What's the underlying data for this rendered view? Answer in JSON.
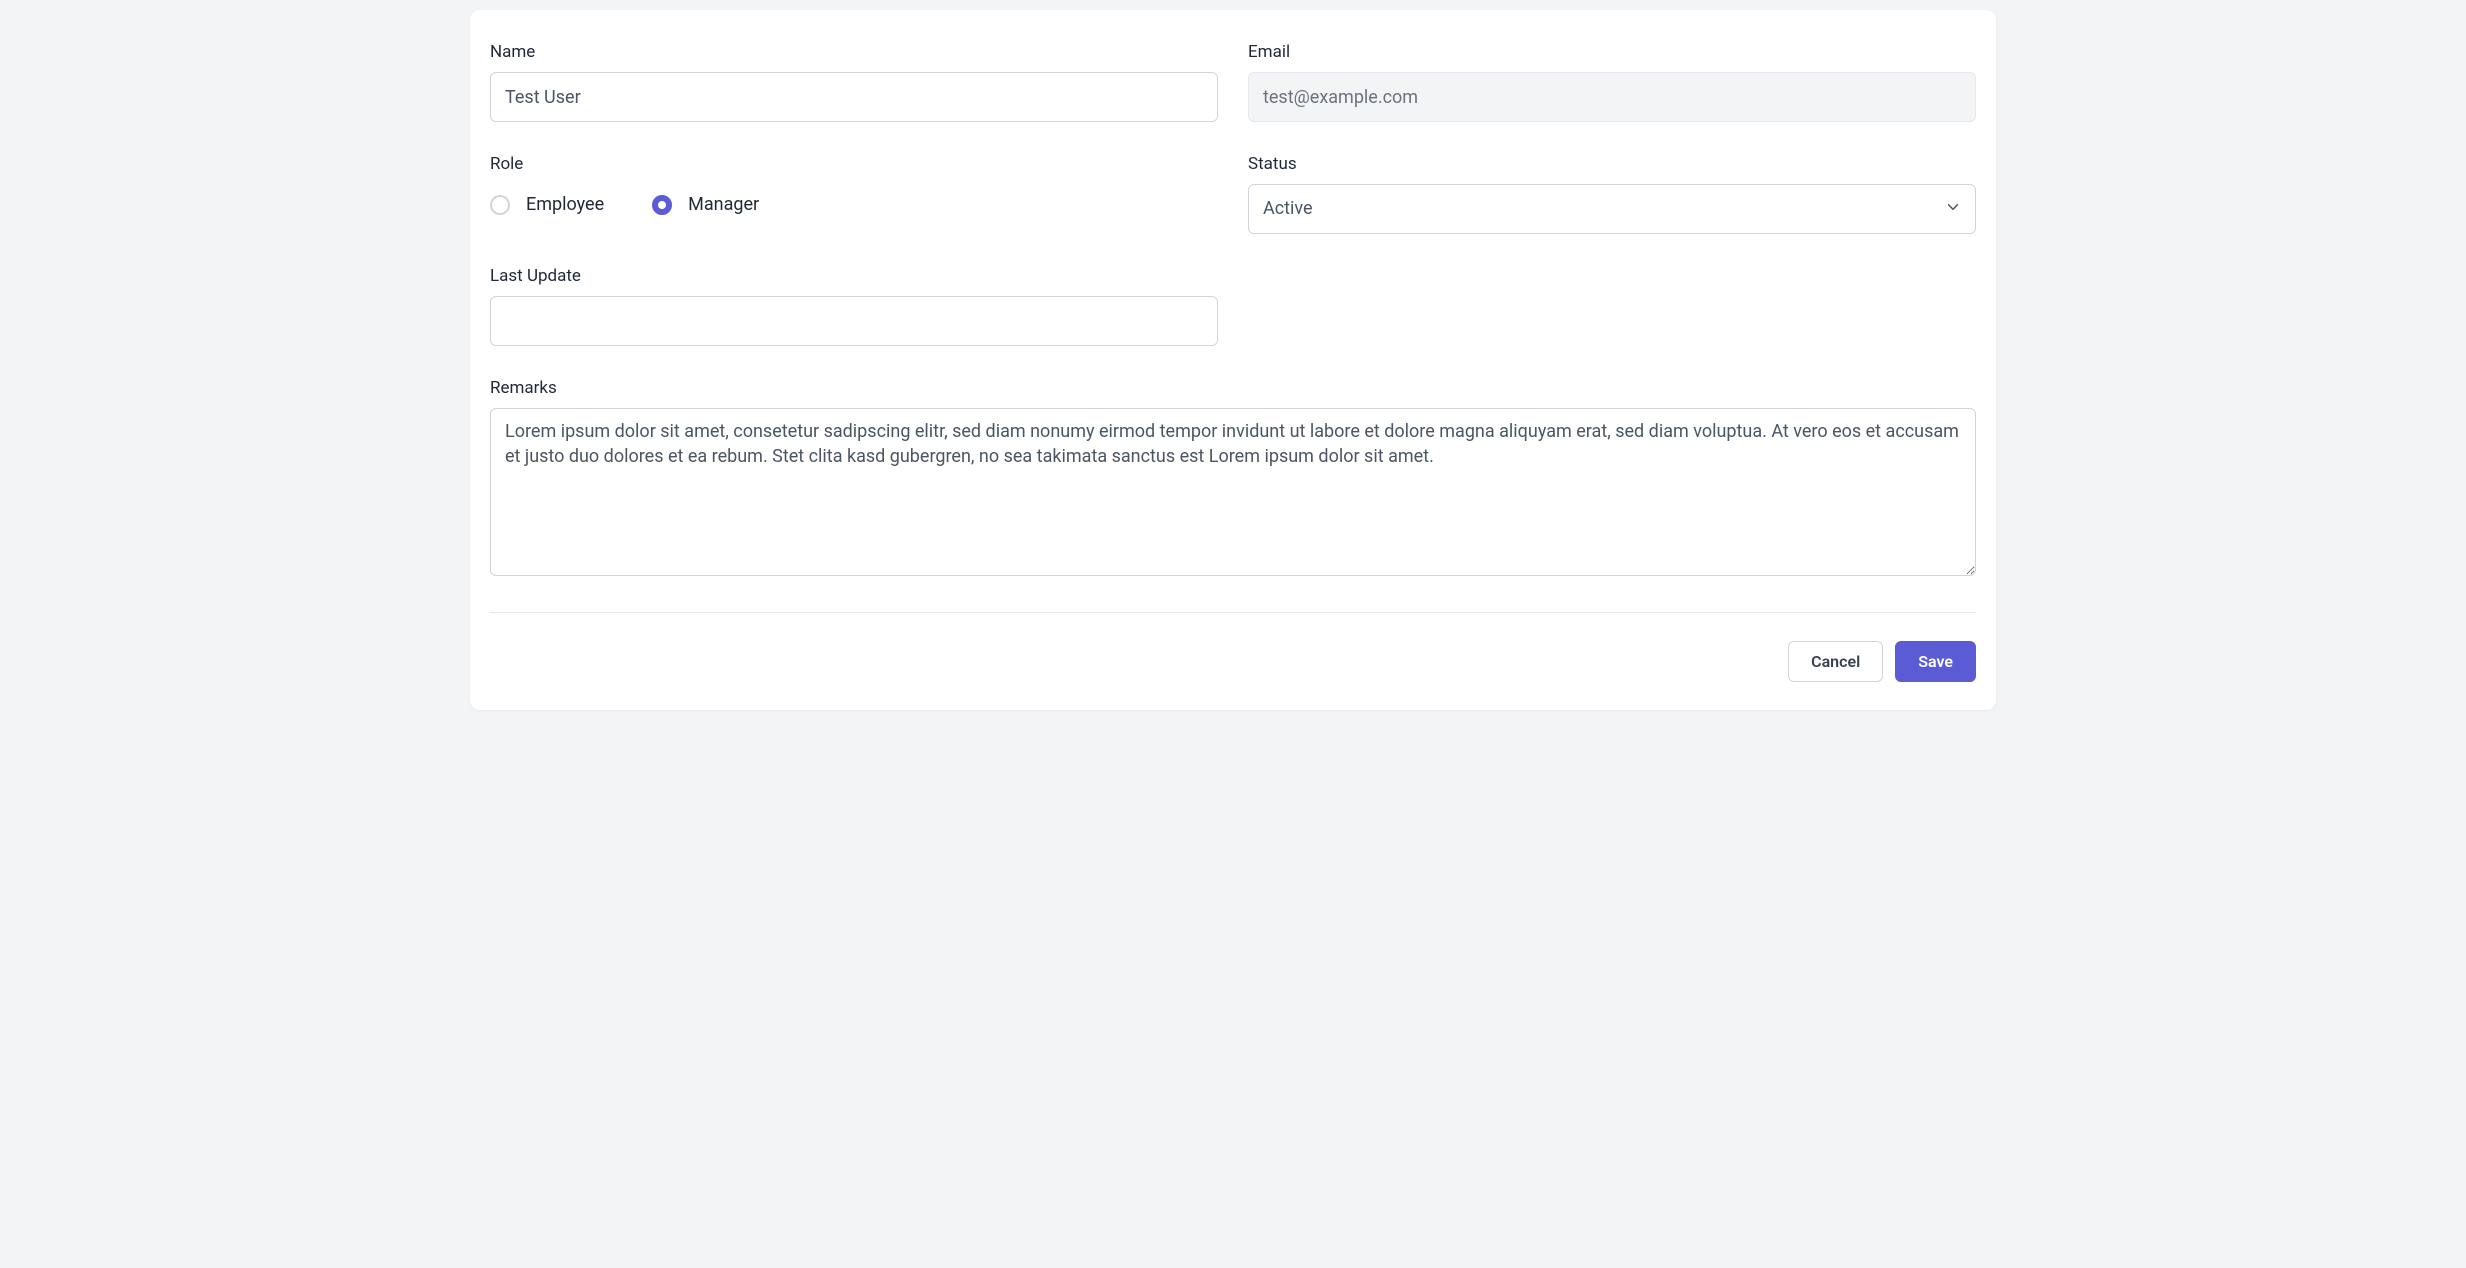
{
  "form": {
    "name": {
      "label": "Name",
      "value": "Test User"
    },
    "email": {
      "label": "Email",
      "value": "test@example.com"
    },
    "role": {
      "label": "Role",
      "options": [
        {
          "label": "Employee",
          "checked": false
        },
        {
          "label": "Manager",
          "checked": true
        }
      ]
    },
    "status": {
      "label": "Status",
      "selected": "Active"
    },
    "last_update": {
      "label": "Last Update",
      "value": ""
    },
    "remarks": {
      "label": "Remarks",
      "value": "Lorem ipsum dolor sit amet, consetetur sadipscing elitr, sed diam nonumy eirmod tempor invidunt ut labore et dolore magna aliquyam erat, sed diam voluptua. At vero eos et accusam et justo duo dolores et ea rebum. Stet clita kasd gubergren, no sea takimata sanctus est Lorem ipsum dolor sit amet."
    }
  },
  "actions": {
    "cancel_label": "Cancel",
    "save_label": "Save"
  }
}
